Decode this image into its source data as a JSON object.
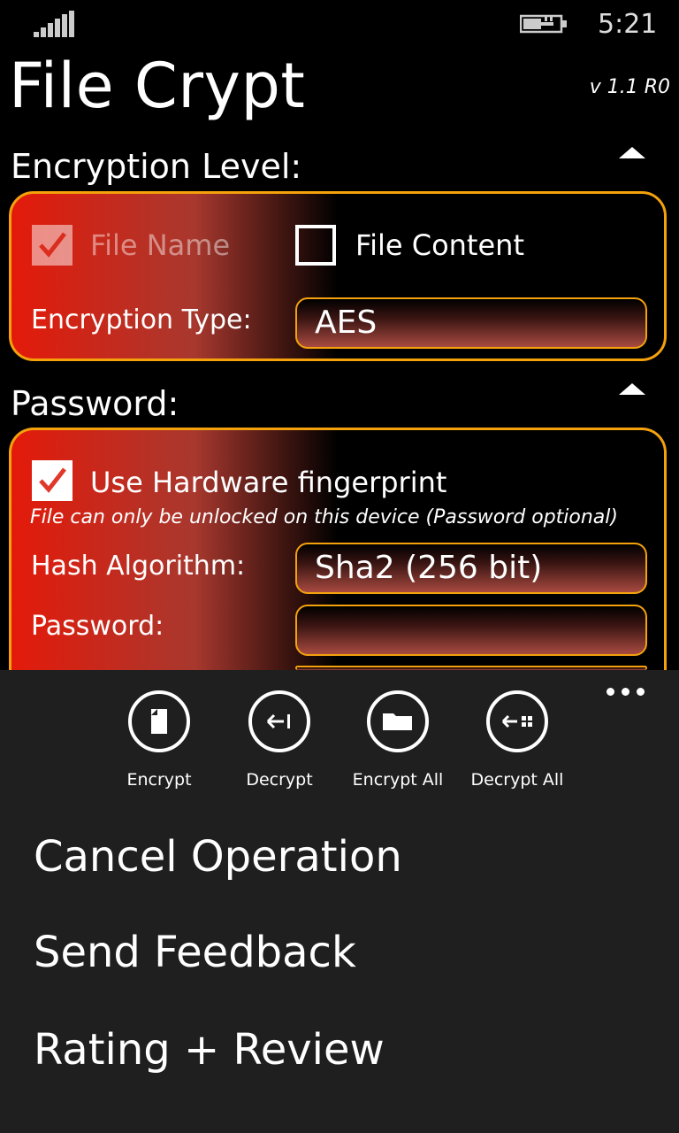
{
  "status_bar": {
    "time": "5:21"
  },
  "header": {
    "title": "File Crypt",
    "version": "v 1.1 R0"
  },
  "encryption": {
    "section_label": "Encryption Level:",
    "file_name_label": "File Name",
    "file_name_checked": true,
    "file_content_label": "File Content",
    "file_content_checked": false,
    "type_label": "Encryption Type:",
    "type_value": "AES"
  },
  "password": {
    "section_label": "Password:",
    "hardware_label": "Use Hardware fingerprint",
    "hardware_checked": true,
    "hardware_hint": "File can only be unlocked on this device (Password optional)",
    "hash_label": "Hash Algorithm:",
    "hash_value": "Sha2 (256 bit)",
    "password_label": "Password:",
    "password_value": ""
  },
  "app_bar": {
    "buttons": [
      {
        "label": "Encrypt",
        "icon": "file-icon"
      },
      {
        "label": "Decrypt",
        "icon": "arrow-back-icon"
      },
      {
        "label": "Encrypt All",
        "icon": "folder-icon"
      },
      {
        "label": "Decrypt All",
        "icon": "arrow-grid-icon"
      }
    ],
    "menu": [
      "Cancel Operation",
      "Send Feedback",
      "Rating + Review"
    ]
  },
  "colors": {
    "accent": "#f4a10c",
    "gradient_start": "#e41a0a",
    "app_bar_bg": "#1f1f1f"
  }
}
